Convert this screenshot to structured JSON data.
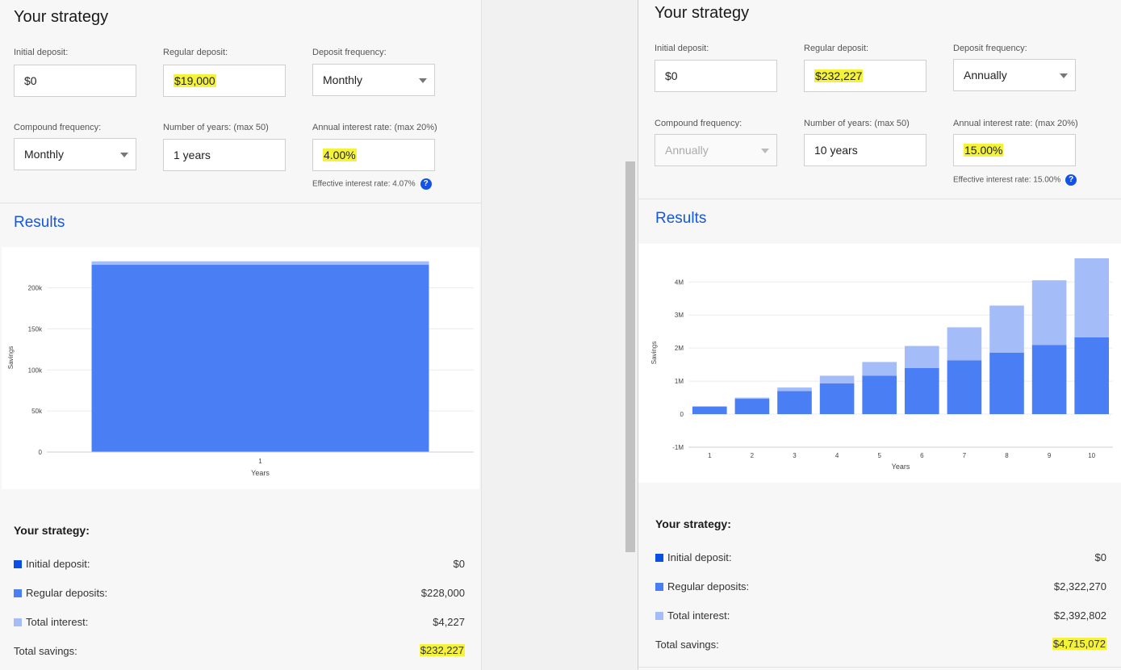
{
  "colors": {
    "initial": "#0b4ee3",
    "regular": "#4a7ef5",
    "interest": "#a4bdf8",
    "accent": "#1457e0",
    "highlight": "#f4f33a"
  },
  "left": {
    "title": "Your strategy",
    "labels": {
      "initial": "Initial deposit:",
      "regular": "Regular deposit:",
      "deposit_freq": "Deposit frequency:",
      "compound_freq": "Compound frequency:",
      "years": "Number of years: (max 50)",
      "rate": "Annual interest rate: (max 20%)"
    },
    "values": {
      "initial": "$0",
      "regular": "$19,000",
      "deposit_freq": "Monthly",
      "compound_freq": "Monthly",
      "years": "1 years",
      "rate": "4.00%"
    },
    "effective": "Effective interest rate: 4.07%",
    "results_title": "Results",
    "summary": {
      "title": "Your strategy:",
      "initial_label": "Initial deposit:",
      "initial_value": "$0",
      "regular_label": "Regular deposits:",
      "regular_value": "$228,000",
      "interest_label": "Total interest:",
      "interest_value": "$4,227",
      "total_label": "Total savings:",
      "total_value": "$232,227"
    }
  },
  "right": {
    "title": "Your strategy",
    "labels": {
      "initial": "Initial deposit:",
      "regular": "Regular deposit:",
      "deposit_freq": "Deposit frequency:",
      "compound_freq": "Compound frequency:",
      "years": "Number of years: (max 50)",
      "rate": "Annual interest rate: (max 20%)"
    },
    "values": {
      "initial": "$0",
      "regular": "$232,227",
      "deposit_freq": "Annually",
      "compound_freq": "Annually",
      "years": "10 years",
      "rate": "15.00%"
    },
    "effective": "Effective interest rate: 15.00%",
    "results_title": "Results",
    "summary": {
      "title": "Your strategy:",
      "initial_label": "Initial deposit:",
      "initial_value": "$0",
      "regular_label": "Regular deposits:",
      "regular_value": "$2,322,270",
      "interest_label": "Total interest:",
      "interest_value": "$2,392,802",
      "total_label": "Total savings:",
      "total_value": "$4,715,072"
    }
  },
  "chart_data": [
    {
      "type": "bar",
      "stacked": true,
      "categories": [
        "1"
      ],
      "series": [
        {
          "values": [
            0
          ]
        },
        {
          "values": [
            228000
          ]
        },
        {
          "values": [
            4227
          ]
        }
      ],
      "xlabel": "Years",
      "ylabel": "Savings",
      "ylim": [
        0,
        230000
      ],
      "yticks": [
        0,
        50000,
        100000,
        150000,
        200000
      ],
      "ytick_labels": [
        "0",
        "50k",
        "100k",
        "150k",
        "200k"
      ]
    },
    {
      "type": "bar",
      "stacked": true,
      "categories": [
        "1",
        "2",
        "3",
        "4",
        "5",
        "6",
        "7",
        "8",
        "9",
        "10"
      ],
      "series": [
        {
          "values": [
            0,
            0,
            0,
            0,
            0,
            0,
            0,
            0,
            0,
            0
          ]
        },
        {
          "values": [
            232227,
            464454,
            696681,
            928908,
            1161135,
            1393362,
            1625589,
            1857816,
            2090043,
            2322270
          ]
        },
        {
          "values": [
            0,
            34834,
            109669,
            233930,
            417294,
            669652,
            1002138,
            1427440,
            1960058,
            2392802
          ]
        }
      ],
      "xlabel": "Years",
      "ylabel": "Savings",
      "ylim": [
        -1000000,
        4715072
      ],
      "yticks": [
        -1000000,
        0,
        1000000,
        2000000,
        3000000,
        4000000
      ],
      "ytick_labels": [
        "-1M",
        "0",
        "1M",
        "2M",
        "3M",
        "4M"
      ]
    }
  ]
}
